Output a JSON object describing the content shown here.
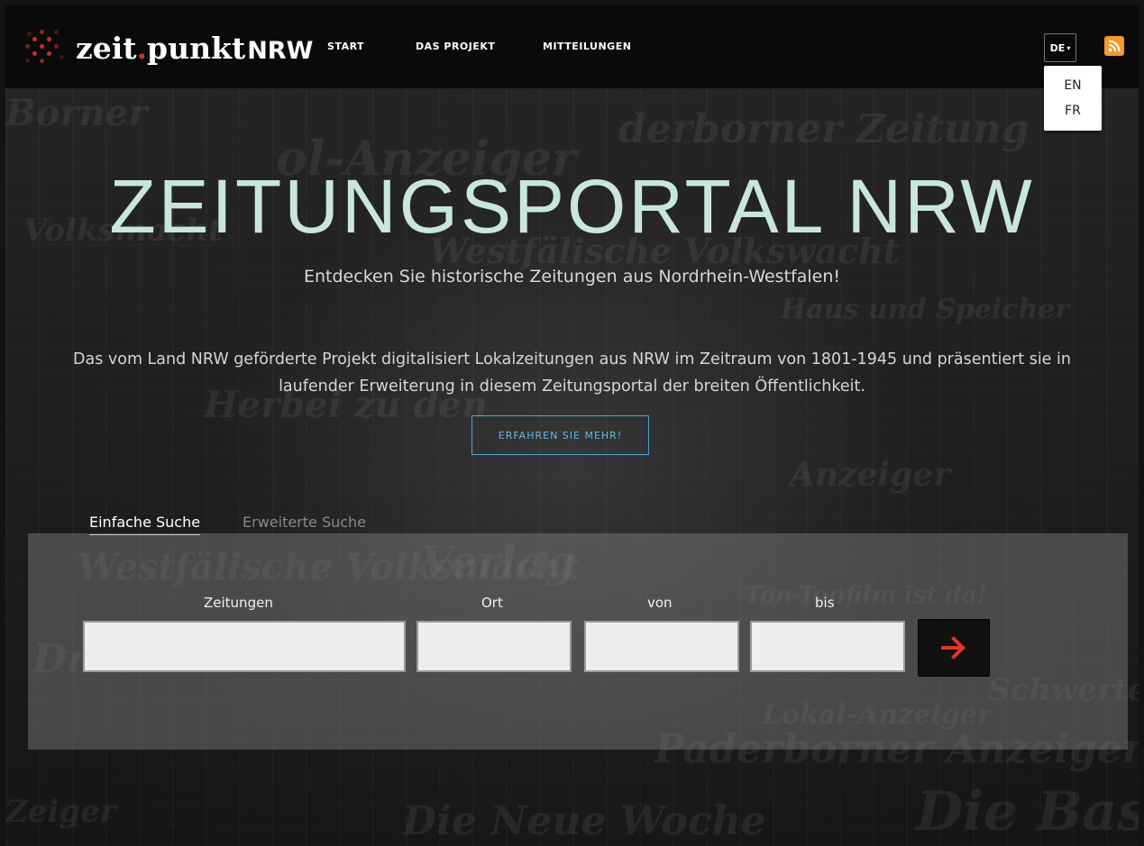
{
  "brand": {
    "name_part1": "zeit",
    "name_dot": ".",
    "name_part2": "punkt",
    "name_suffix": "NRW",
    "accent": "#c8322b"
  },
  "nav": {
    "items": [
      {
        "label": "START"
      },
      {
        "label": "DAS PROJEKT"
      },
      {
        "label": "MITTEILUNGEN"
      }
    ]
  },
  "language": {
    "current": "DE",
    "caret": "▾",
    "options": [
      {
        "label": "EN"
      },
      {
        "label": "FR"
      }
    ]
  },
  "rss": {
    "icon": "rss-feed-icon",
    "color": "#f39a2c"
  },
  "hero": {
    "title": "ZEITUNGSPORTAL NRW",
    "subtitle": "Entdecken Sie historische Zeitungen aus Nordrhein-Westfalen!",
    "description": "Das vom Land NRW geförderte Projekt digitalisiert Lokalzeitungen aus NRW im Zeitraum von 1801-1945 und präsentiert sie in laufender Erweiterung in diesem Zeitungsportal der breiten Öffentlichkeit.",
    "cta_label": "ERFAHREN SIE MEHR!",
    "title_color": "#c9e6dc",
    "cta_color": "#4aa3cf"
  },
  "search": {
    "tabs": [
      {
        "label": "Einfache Suche",
        "active": true
      },
      {
        "label": "Erweiterte Suche",
        "active": false
      }
    ],
    "fields": [
      {
        "label": "Zeitungen",
        "value": ""
      },
      {
        "label": "Ort",
        "value": ""
      },
      {
        "label": "von",
        "value": ""
      },
      {
        "label": "bis",
        "value": ""
      }
    ],
    "submit_icon": "arrow-right-icon",
    "submit_color": "#e0362c"
  }
}
